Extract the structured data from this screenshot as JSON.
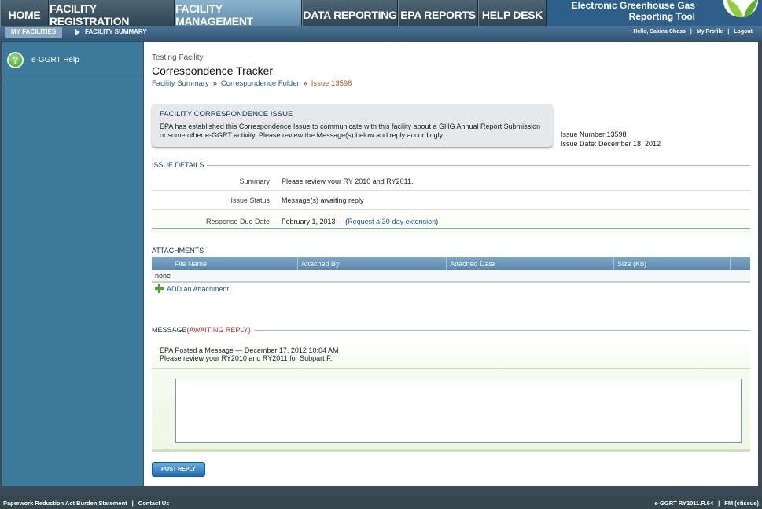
{
  "nav": {
    "tabs": [
      "HOME",
      "FACILITY REGISTRATION",
      "FACILITY MANAGEMENT",
      "DATA REPORTING",
      "EPA REPORTS",
      "HELP DESK"
    ],
    "active_tab": "FACILITY MANAGEMENT",
    "brand_line1": "Electronic Greenhouse Gas",
    "brand_line2": "Reporting Tool"
  },
  "subnav": {
    "my_facilities": "MY FACILITIES",
    "facility_summary": "FACILITY SUMMARY",
    "greeting": "Hello, Sakina Chess",
    "my_profile": "My Profile",
    "logout": "Logout"
  },
  "sidebar": {
    "help_label": "e-GGRT Help"
  },
  "page": {
    "facility_name": "Testing Facility",
    "title": "Correspondence Tracker",
    "breadcrumb": {
      "facility_summary": "Facility Summary",
      "correspondence_folder": "Correspondence Folder",
      "current": "Issue 13598"
    }
  },
  "issue_box": {
    "title": "FACILITY CORRESPONDENCE ISSUE",
    "text": "EPA has established this Correspondence Issue to communicate with this facility about a GHG Annual Report Submission or some other e-GGRT activity. Please review the Message(s) below and reply accordingly.",
    "issue_number": "Issue Number:13598",
    "issue_date": "Issue Date: December 18, 2012"
  },
  "details": {
    "header": "ISSUE DETAILS",
    "summary_label": "Summary",
    "summary_value": "Please review your RY 2010 and RY2011.",
    "status_label": "Issue Status",
    "status_value": "Message(s) awaiting reply",
    "due_label": "Response Due Date",
    "due_value": "February 1, 2013",
    "extension_open": "(",
    "extension_link": "Request a 30-day extension",
    "extension_close": ")"
  },
  "attachments": {
    "header": "ATTACHMENTS",
    "columns": [
      "File Name",
      "Attached By",
      "Attached Date",
      "Size (Kb)"
    ],
    "empty": "none",
    "add_label": "ADD an Attachment"
  },
  "message": {
    "header": "MESSAGE",
    "header_status": "(AWAITING REPLY)",
    "posted_line": "EPA Posted a Message — December 17, 2012 10:04 AM",
    "body": "Please review your RY2010 and RY2011 for Subpart F.",
    "reply_value": "",
    "post_button": "POST REPLY"
  },
  "footer": {
    "paperwork": "Paperwork Reduction Act Burden Statement",
    "contact": "Contact Us",
    "version": "e-GGRT RY2011.R.64",
    "fm": "FM (ctissue)"
  },
  "colors": {
    "nav_bg": "#2e5f8a",
    "sidebar": "#3c7a9b",
    "link": "#1d5e91",
    "awaiting": "#c0282d"
  }
}
